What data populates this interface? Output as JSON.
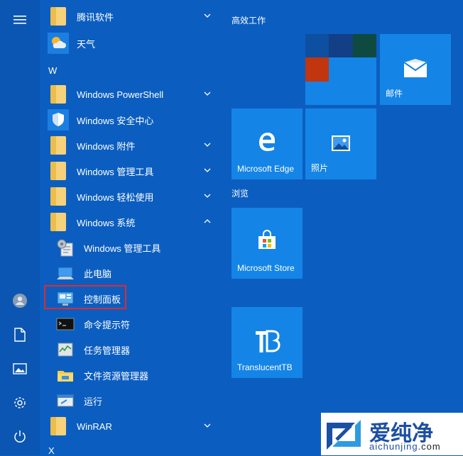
{
  "app_list": {
    "apps": [
      {
        "label": "腾讯软件",
        "icon": "folder-icon"
      },
      {
        "label": "天气",
        "icon": "weather-icon"
      },
      {
        "label": "Windows PowerShell",
        "icon": "folder-icon"
      },
      {
        "label": "Windows 安全中心",
        "icon": "shield-icon"
      },
      {
        "label": "Windows 附件",
        "icon": "folder-icon"
      },
      {
        "label": "Windows 管理工具",
        "icon": "folder-icon"
      },
      {
        "label": "Windows 轻松使用",
        "icon": "folder-icon"
      },
      {
        "label": "Windows 系统",
        "icon": "folder-icon"
      },
      {
        "label": "Windows 管理工具",
        "icon": "admin-tools-icon"
      },
      {
        "label": "此电脑",
        "icon": "this-pc-icon"
      },
      {
        "label": "控制面板",
        "icon": "control-panel-icon"
      },
      {
        "label": "命令提示符",
        "icon": "cmd-icon"
      },
      {
        "label": "任务管理器",
        "icon": "task-manager-icon"
      },
      {
        "label": "文件资源管理器",
        "icon": "file-explorer-icon"
      },
      {
        "label": "运行",
        "icon": "run-icon"
      },
      {
        "label": "WinRAR",
        "icon": "folder-icon"
      }
    ],
    "letter_w": "W",
    "letter_x": "X"
  },
  "tiles": {
    "group1_title": "高效工作",
    "group2_title": "浏览",
    "mail": "邮件",
    "edge": "Microsoft Edge",
    "photos": "照片",
    "store": "Microsoft Store",
    "translucent": "TranslucentTB"
  },
  "watermark": {
    "title": "爱纯净",
    "domain_left": "aichunjing",
    "domain_right": ".com"
  },
  "colors": {
    "background": "#0b5ec0",
    "tile": "#1485e6",
    "highlight": "#e02a2a"
  }
}
